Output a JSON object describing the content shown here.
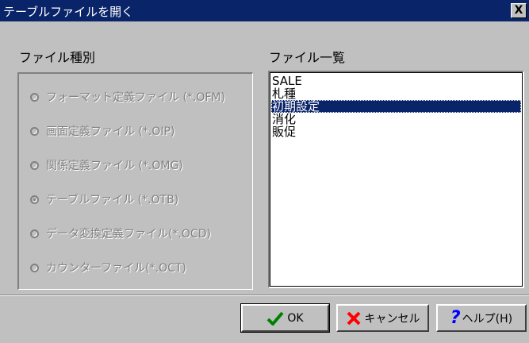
{
  "window": {
    "title": "テーブルファイルを開く",
    "close_label": "X"
  },
  "file_type_group": {
    "label": "ファイル種別",
    "options": [
      {
        "label": "フォーマット定義ファイル (*.OFM)",
        "selected": false
      },
      {
        "label": "画面定義ファイル (*.OIP)",
        "selected": false
      },
      {
        "label": "関係定義ファイル (*.OMG)",
        "selected": false
      },
      {
        "label": "テーブルファイル (*.OTB)",
        "selected": true
      },
      {
        "label": "データ変換定義ファイル(*.OCD)",
        "selected": false
      },
      {
        "label": "カウンターファイル(*.OCT)",
        "selected": false
      }
    ],
    "enabled": false
  },
  "file_list": {
    "label": "ファイル一覧",
    "items": [
      "SALE",
      "札種",
      "初期設定",
      "消化",
      "販促"
    ],
    "selected_index": 2
  },
  "buttons": {
    "ok_label": "OK",
    "cancel_label": "キャンセル",
    "help_label": "ヘルプ(H)"
  },
  "colors": {
    "titlebar": "#0a246a",
    "face": "#c0c0c0",
    "ok_check": "#008000",
    "cancel_x": "#ff0000",
    "help_question": "#0000ff"
  }
}
